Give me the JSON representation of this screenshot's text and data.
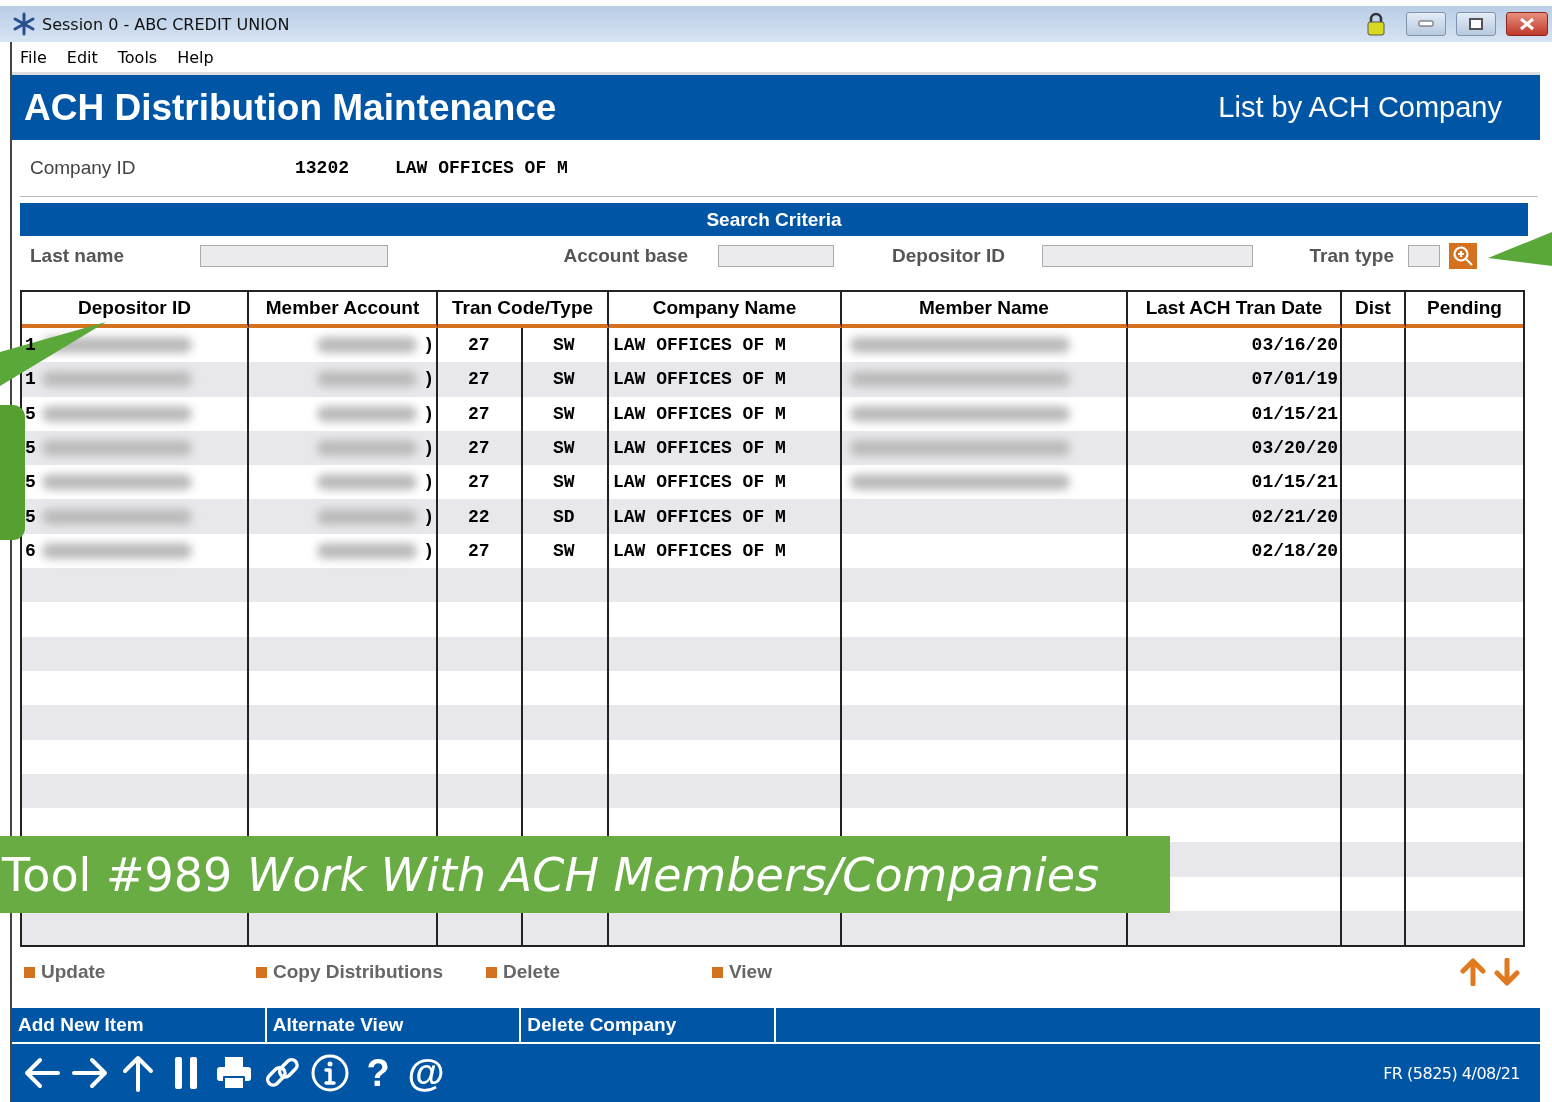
{
  "window": {
    "title": "Session 0  - ABC CREDIT UNION"
  },
  "menu": [
    "File",
    "Edit",
    "Tools",
    "Help"
  ],
  "header": {
    "title": "ACH Distribution Maintenance",
    "subtitle": "List by ACH Company"
  },
  "company": {
    "label": "Company ID",
    "id": "13202",
    "name": "LAW OFFICES OF M"
  },
  "search": {
    "title": "Search Criteria",
    "fields": [
      {
        "label": "Last name"
      },
      {
        "label": "Account base"
      },
      {
        "label": "Depositor ID"
      },
      {
        "label": "Tran type"
      }
    ]
  },
  "table": {
    "columns": [
      "Depositor ID",
      "Member Account",
      "Tran Code/Type",
      "Company Name",
      "Member Name",
      "Last ACH Tran Date",
      "Dist",
      "Pending"
    ],
    "rows": [
      {
        "depositor_id": "1",
        "member_account": ")",
        "tran_code": "27",
        "type": "SW",
        "company_name": "LAW OFFICES OF M",
        "member_name_redacted": true,
        "last_ach_tran_date": "03/16/20"
      },
      {
        "depositor_id": "1",
        "member_account": ")",
        "tran_code": "27",
        "type": "SW",
        "company_name": "LAW OFFICES OF M",
        "member_name_redacted": true,
        "last_ach_tran_date": "07/01/19"
      },
      {
        "depositor_id": "5",
        "member_account": ")",
        "tran_code": "27",
        "type": "SW",
        "company_name": "LAW OFFICES OF M",
        "member_name_redacted": true,
        "last_ach_tran_date": "01/15/21"
      },
      {
        "depositor_id": "5",
        "member_account": ")",
        "tran_code": "27",
        "type": "SW",
        "company_name": "LAW OFFICES OF M",
        "member_name_redacted": true,
        "last_ach_tran_date": "03/20/20"
      },
      {
        "depositor_id": "5",
        "member_account": ")",
        "tran_code": "27",
        "type": "SW",
        "company_name": "LAW OFFICES OF M",
        "member_name_redacted": true,
        "last_ach_tran_date": "01/15/21"
      },
      {
        "depositor_id": "5",
        "member_account": ")",
        "tran_code": "22",
        "type": "SD",
        "company_name": "LAW OFFICES OF M",
        "member_name_redacted": false,
        "last_ach_tran_date": "02/21/20"
      },
      {
        "depositor_id": "6",
        "member_account": ")",
        "tran_code": "27",
        "type": "SW",
        "company_name": "LAW OFFICES OF M",
        "member_name_redacted": false,
        "last_ach_tran_date": "02/18/20"
      }
    ]
  },
  "actions": [
    "Update",
    "Copy Distributions",
    "Delete",
    "View"
  ],
  "function_keys": [
    "Add New Item",
    "Alternate View",
    "Delete Company"
  ],
  "toolbar_glyphs": [
    "?",
    "@"
  ],
  "status": "FR (5825) 4/08/21",
  "callout": {
    "text": "Tool #989 *Work With ACH Members/Companies*"
  }
}
